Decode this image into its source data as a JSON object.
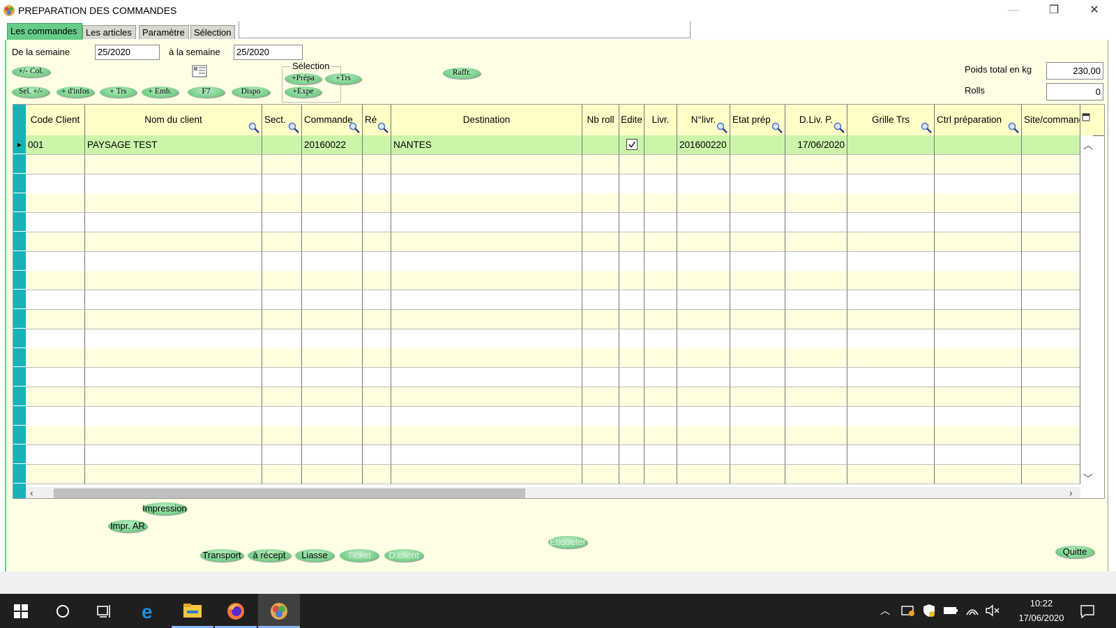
{
  "window": {
    "title": "PREPARATION DES COMMANDES",
    "controls": [
      "minimize",
      "restore",
      "close"
    ]
  },
  "tabs": [
    {
      "label": "Les commandes",
      "active": true
    },
    {
      "label": "Les articles",
      "active": false
    },
    {
      "label": "Paramètre",
      "active": false
    },
    {
      "label": "Sélection",
      "active": false
    }
  ],
  "filters": {
    "from_week_label": "De la semaine",
    "from_week_value": "25/2020",
    "to_week_label": "à la semaine",
    "to_week_value": "25/2020"
  },
  "toolbar": {
    "col_toggle": "+/- Col.",
    "sel_toggle": "Sel. +/-",
    "more_info": "+ d'infos",
    "plus_trs": "+ Trs",
    "plus_emb": "+ Emb.",
    "f7": "F7",
    "dispo": "Dispo",
    "refresh": "Raffr."
  },
  "selection_group": {
    "caption": "Sélection",
    "prepa": "+Prépa",
    "trs": "+Trs",
    "expe": "+Expe"
  },
  "totals": {
    "weight_label": "Poids total en kg",
    "weight_value": "230,00",
    "rolls_label": "Rolls",
    "rolls_value": "0"
  },
  "grid": {
    "columns": [
      "Code Client",
      "Nom du client",
      "Sect.",
      "Commande",
      "Ré",
      "Destination",
      "Nb roll",
      "Edite",
      "Livr.",
      "N°livr.",
      "Etat prép",
      "D.Liv. P.",
      "Grille Trs",
      "Ctrl préparation",
      "Site/commande"
    ],
    "rows": [
      {
        "code_client": "001",
        "nom_client": "PAYSAGE TEST",
        "sect": "",
        "commande": "20160022",
        "re": "",
        "destination": "NANTES",
        "nb_roll": "",
        "edite": true,
        "livr": "",
        "num_livr": "201600220",
        "etat_prep": "",
        "date_liv": "17/06/2020",
        "grille_trs": "",
        "ctrl_prep": "",
        "site_commande": ""
      }
    ]
  },
  "bottom": {
    "impression": "Impression",
    "impr_ar": "Impr. AR",
    "etiqueter": "Etiqueter",
    "transport": "Transport",
    "a_recept": "à récept",
    "liasse": "Liasse",
    "ticket": "Ticket",
    "d_client": "D.client",
    "quitte": "Quitte"
  },
  "taskbar": {
    "time": "10:22",
    "date": "17/06/2020",
    "apps": [
      "start-icon",
      "cortana-icon",
      "task-view-icon",
      "edge-icon",
      "file-explorer-icon",
      "firefox-icon",
      "app-icon"
    ]
  },
  "colors": {
    "panel_bg": "#ffffe6",
    "tab_active": "#66cc88",
    "row_selector": "#18b2b6",
    "selected_row": "#ccf5aa",
    "header_bg": "#ffffc8",
    "button_green": "#83d494"
  }
}
